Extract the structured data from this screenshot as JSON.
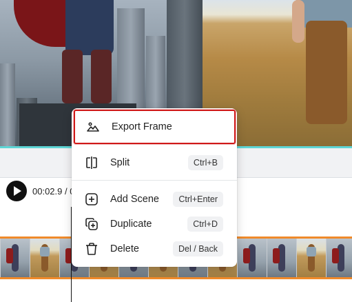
{
  "player": {
    "time_display": "00:02.9 / 0"
  },
  "context_menu": {
    "items": [
      {
        "label": "Export Frame",
        "shortcut": "",
        "icon": "image-icon"
      },
      {
        "label": "Split",
        "shortcut": "Ctrl+B",
        "icon": "split-icon"
      },
      {
        "label": "Add Scene",
        "shortcut": "Ctrl+Enter",
        "icon": "add-scene-icon"
      },
      {
        "label": "Duplicate",
        "shortcut": "Ctrl+D",
        "icon": "duplicate-icon"
      },
      {
        "label": "Delete",
        "shortcut": "Del / Back",
        "icon": "trash-icon"
      }
    ]
  },
  "colors": {
    "highlight_border": "#d01818",
    "timeline_accent": "#f08a2a",
    "preview_divider": "#5ed6d6"
  }
}
